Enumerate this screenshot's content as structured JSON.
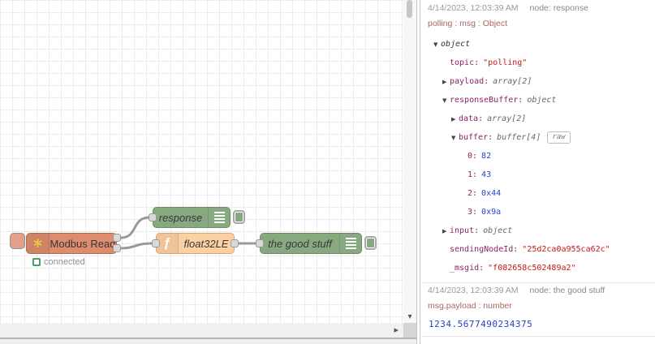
{
  "glyphs": {
    "down": "▼",
    "right": "▶",
    "scroll_down": "▾",
    "scroll_right": "▸",
    "modbus_icon": "✱",
    "function_icon": "ƒ"
  },
  "colors": {
    "modbus_node": "#dd8c6d",
    "debug_node": "#87a980",
    "function_node": "#fdd0a2",
    "wire": "#999999",
    "key_text": "#8a2464",
    "string_text": "#c41a16",
    "number_text": "#2840c8",
    "path_text": "#aa6666",
    "status_green": "#4b9e63"
  },
  "canvas": {
    "modbus": {
      "label": "Modbus Read",
      "status_label": "connected"
    },
    "response": {
      "label": "response"
    },
    "function": {
      "label": "float32LE"
    },
    "debug2": {
      "label": "the good stuff"
    }
  },
  "debug": {
    "messages": [
      {
        "date": "4/14/2023, 12:03:39 AM",
        "node": "node: response",
        "path": "polling : msg : Object",
        "tree": [
          {
            "indent": 0,
            "arrow": "down",
            "value": "object",
            "vtype": "object"
          },
          {
            "indent": 1,
            "key": "topic",
            "value": "\"polling\"",
            "vtype": "string"
          },
          {
            "indent": 1,
            "arrow": "right",
            "key": "payload",
            "value": "array[2]",
            "vtype": "type"
          },
          {
            "indent": 1,
            "arrow": "down",
            "key": "responseBuffer",
            "value": "object",
            "vtype": "type"
          },
          {
            "indent": 2,
            "arrow": "right",
            "key": "data",
            "value": "array[2]",
            "vtype": "type"
          },
          {
            "indent": 2,
            "arrow": "down",
            "key": "buffer",
            "value": "buffer[4]",
            "vtype": "type",
            "button": "raw"
          },
          {
            "indent": 3,
            "key": "0",
            "value": "82",
            "vtype": "number"
          },
          {
            "indent": 3,
            "key": "1",
            "value": "43",
            "vtype": "number"
          },
          {
            "indent": 3,
            "key": "2",
            "value": "0x44",
            "vtype": "number"
          },
          {
            "indent": 3,
            "key": "3",
            "value": "0x9a",
            "vtype": "number"
          },
          {
            "indent": 1,
            "arrow": "right",
            "key": "input",
            "value": "object",
            "vtype": "type"
          },
          {
            "indent": 1,
            "key": "sendingNodeId",
            "value": "\"25d2ca0a955ca62c\"",
            "vtype": "string"
          },
          {
            "indent": 1,
            "key": "_msgid",
            "value": "\"f082658c502489a2\"",
            "vtype": "string"
          }
        ]
      },
      {
        "date": "4/14/2023, 12:03:39 AM",
        "node": "node: the good stuff",
        "path": "msg.payload : number",
        "value": "1234.5677490234375"
      }
    ]
  }
}
